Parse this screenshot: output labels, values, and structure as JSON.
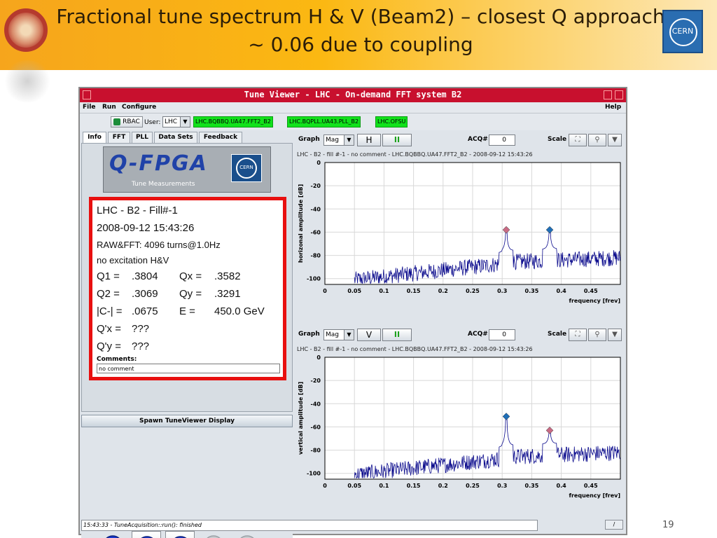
{
  "slide": {
    "title": "Fractional tune spectrum H & V (Beam2) – closest Q approach ~ 0.06 due to coupling",
    "page_number": "19",
    "cern_logo_text": "CERN"
  },
  "window": {
    "title": "Tune Viewer - LHC - On-demand FFT system B2"
  },
  "menu": {
    "file": "File",
    "run": "Run",
    "configure": "Configure",
    "help": "Help"
  },
  "toolbar": {
    "rbac_label": "RBAC",
    "user_label": "User:",
    "user_value": "LHC",
    "devices": [
      "LHC.BQBBQ.UA47.FFT2_B2",
      "LHC.BQPLL.UA43.PLL_B2",
      "LHC.OFSU"
    ]
  },
  "tabs": [
    "Info",
    "FFT",
    "PLL",
    "Data Sets",
    "Feedback"
  ],
  "qfpga": {
    "title": "Q-FPGA",
    "subtitle": "Tune Measurements",
    "logo_text": "CERN"
  },
  "info": {
    "line1": "LHC - B2 - Fill#-1",
    "line2": "2008-09-12 15:43:26",
    "line3": "RAW&FFT: 4096 turns@1.0Hz",
    "line4": "no excitation H&V",
    "q1_label": "Q1 =",
    "q1_value": ".3804",
    "qx_label": "Qx =",
    "qx_value": ".3582",
    "q2_label": "Q2 =",
    "q2_value": ".3069",
    "qy_label": "Qy =",
    "qy_value": ".3291",
    "c_label": "|C-| =",
    "c_value": ".0675",
    "e_label": "E =",
    "e_value": "450.0 GeV",
    "qpx_label": "Q'x =",
    "qpx_value": "???",
    "qpy_label": "Q'y =",
    "qpy_value": "???",
    "comments_label": "Comments:",
    "comment_value": "no comment"
  },
  "spawn_button": "Spawn TuneViewer Display",
  "status_text": "15:43:33 - TuneAcquisition::run(): finished",
  "status_button": "/",
  "plot_controls": {
    "graph_label": "Graph",
    "mode": "Mag",
    "acq_label": "ACQ#",
    "acq_value": "0",
    "scale_label": "Scale",
    "pause_label": "II",
    "h_label": "H",
    "v_label": "V"
  },
  "chart_data": [
    {
      "type": "line",
      "subtitle": "LHC - B2 - fill #-1 - no comment - LHC.BQBBQ.UA47.FFT2_B2 - 2008-09-12 15:43:26",
      "xlabel": "frequency [frev]",
      "ylabel": "horizonal amplitude [dB]",
      "xlim": [
        0,
        0.5
      ],
      "ylim": [
        -105,
        0
      ],
      "xticks": [
        "0",
        "0.05",
        "0.1",
        "0.15",
        "0.2",
        "0.25",
        "0.3",
        "0.35",
        "0.4",
        "0.45"
      ],
      "yticks": [
        "0",
        "-20",
        "-40",
        "-60",
        "-80",
        "-100"
      ],
      "trace_color": "#0a0a8c",
      "markers": [
        {
          "x": 0.3069,
          "y": -58,
          "color": "#c96a84"
        },
        {
          "x": 0.3804,
          "y": -58,
          "color": "#1f6fb8"
        }
      ]
    },
    {
      "type": "line",
      "subtitle": "LHC - B2 - fill #-1 - no comment - LHC.BQBBQ.UA47.FFT2_B2 - 2008-09-12 15:43:26",
      "xlabel": "frequency [frev]",
      "ylabel": "vertical amplitude [dB]",
      "xlim": [
        0,
        0.5
      ],
      "ylim": [
        -105,
        0
      ],
      "xticks": [
        "0",
        "0.05",
        "0.1",
        "0.15",
        "0.2",
        "0.25",
        "0.3",
        "0.35",
        "0.4",
        "0.45"
      ],
      "yticks": [
        "0",
        "-20",
        "-40",
        "-60",
        "-80",
        "-100"
      ],
      "trace_color": "#0a0a8c",
      "markers": [
        {
          "x": 0.3069,
          "y": -51,
          "color": "#1f6fb8"
        },
        {
          "x": 0.3804,
          "y": -63,
          "color": "#c96a84"
        }
      ]
    }
  ]
}
